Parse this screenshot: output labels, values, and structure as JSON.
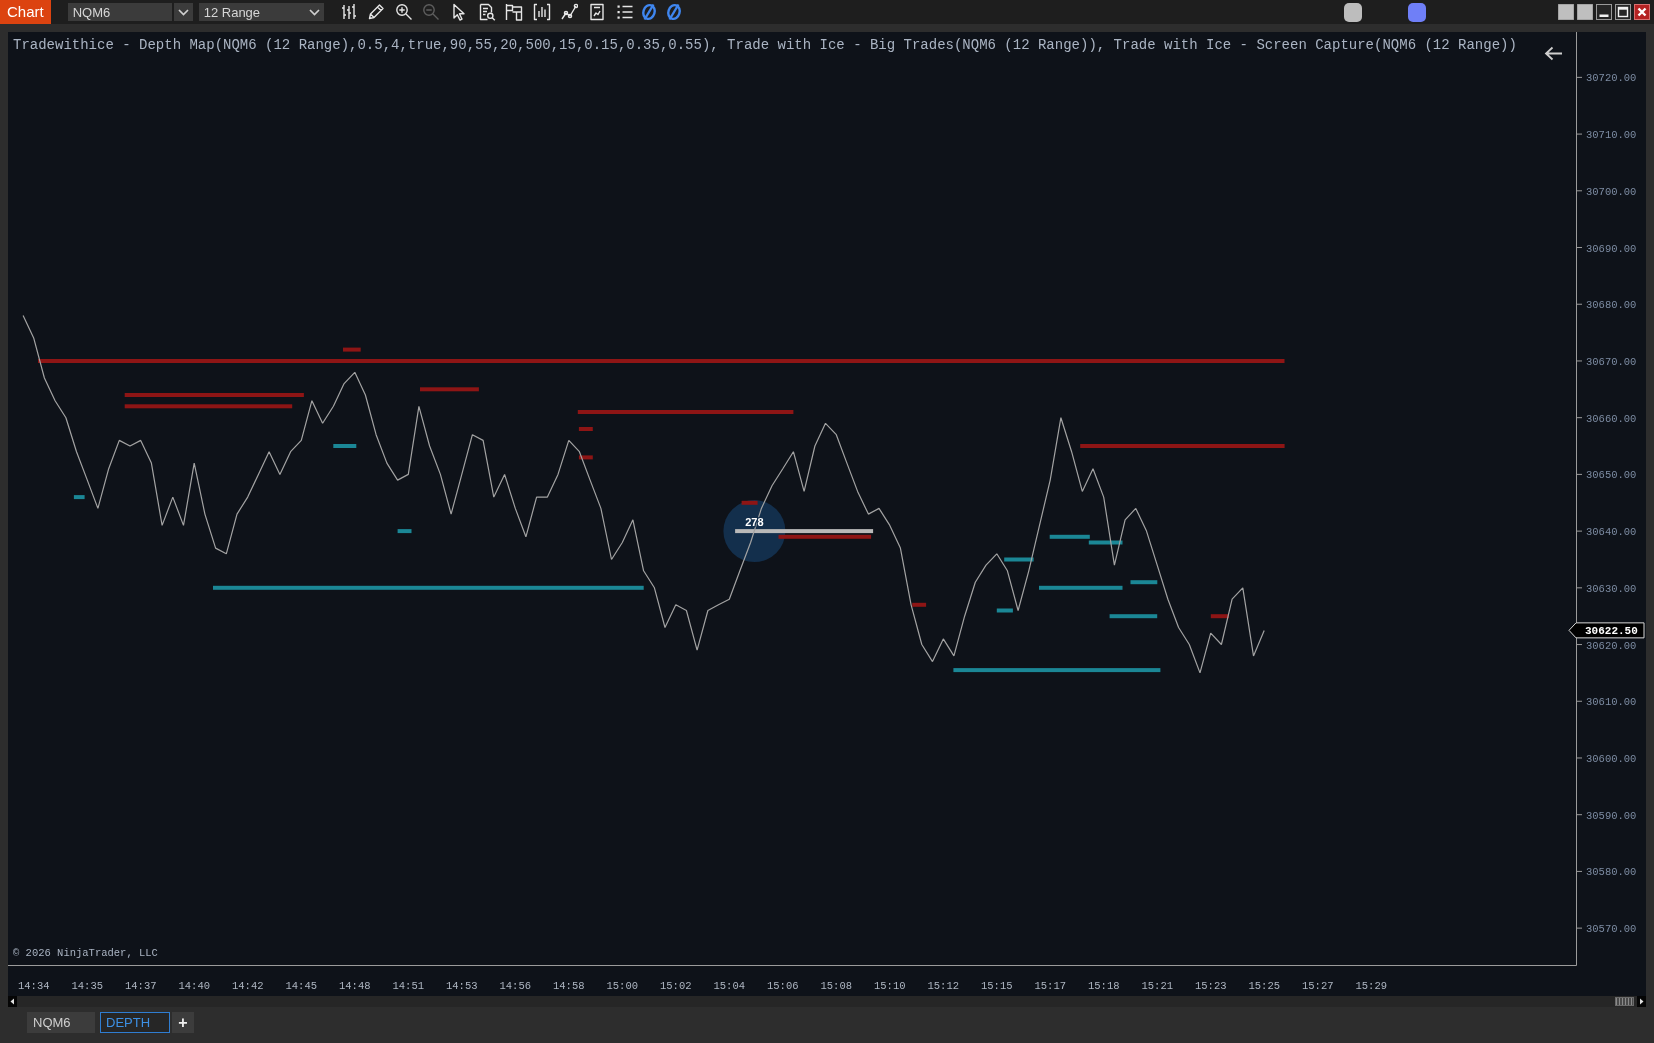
{
  "toolbar": {
    "title": "Chart",
    "instrument": "NQM6",
    "interval": "12 Range",
    "tools": [
      {
        "kind": "bars",
        "disabled": false
      },
      {
        "kind": "pencil",
        "disabled": false
      },
      {
        "kind": "zoom_in",
        "disabled": false
      },
      {
        "kind": "zoom_out",
        "disabled": true
      },
      {
        "kind": "pointer",
        "disabled": false
      },
      {
        "kind": "doc_search",
        "disabled": false
      },
      {
        "kind": "panel",
        "disabled": false
      },
      {
        "kind": "bar_chart",
        "disabled": false
      },
      {
        "kind": "line_chart",
        "disabled": false
      },
      {
        "kind": "doc_chart",
        "disabled": false
      },
      {
        "kind": "list",
        "disabled": false
      },
      {
        "kind": "slashed_circle",
        "disabled": false
      },
      {
        "kind": "slashed_circle",
        "disabled": false
      }
    ],
    "link_buttons": [
      {
        "color": "#bdbdbd"
      },
      {
        "color": "#6f7ff7"
      }
    ]
  },
  "chart": {
    "legend": "Tradewithice - Depth Map(NQM6 (12 Range),0.5,4,true,90,55,20,500,15,0.15,0.35,0.55), Trade with Ice - Big Trades(NQM6 (12 Range)), Trade with Ice - Screen Capture(NQM6 (12 Range))",
    "copyright": "© 2026 NinjaTrader, LLC",
    "last_price": "30622.50",
    "big_trade_label": "278",
    "chart_data": {
      "type": "line",
      "ylim": [
        30563.5,
        30728
      ],
      "categories": [
        null,
        null,
        "14:34",
        null,
        null,
        null,
        null,
        "14:35",
        null,
        null,
        null,
        null,
        "14:37",
        null,
        null,
        null,
        null,
        "14:40",
        null,
        null,
        null,
        null,
        "14:42",
        null,
        null,
        null,
        null,
        "14:45",
        null,
        null,
        null,
        null,
        "14:48",
        null,
        null,
        null,
        null,
        "14:51",
        null,
        null,
        null,
        null,
        "14:53",
        null,
        null,
        null,
        null,
        "14:56",
        null,
        null,
        null,
        null,
        "14:58",
        null,
        null,
        null,
        null,
        "15:00",
        null,
        null,
        null,
        null,
        "15:02",
        null,
        null,
        null,
        null,
        "15:04",
        null,
        null,
        null,
        null,
        "15:06",
        null,
        null,
        null,
        null,
        "15:08",
        null,
        null,
        null,
        null,
        "15:10",
        null,
        null,
        null,
        null,
        "15:12",
        null,
        null,
        null,
        null,
        "15:15",
        null,
        null,
        null,
        null,
        "15:17",
        null,
        null,
        null,
        null,
        "15:18",
        null,
        null,
        null,
        null,
        "15:21",
        null,
        null,
        null,
        null,
        "15:23",
        null,
        null,
        null,
        null,
        "15:25",
        null,
        null,
        null,
        null,
        "15:27",
        null,
        null,
        null,
        null,
        "15:29"
      ],
      "yticks": [
        {
          "value": 30720,
          "label": "30720.00"
        },
        {
          "value": 30710,
          "label": "30710.00"
        },
        {
          "value": 30700,
          "label": "30700.00"
        },
        {
          "value": 30690,
          "label": "30690.00"
        },
        {
          "value": 30680,
          "label": "30680.00"
        },
        {
          "value": 30670,
          "label": "30670.00"
        },
        {
          "value": 30660,
          "label": "30660.00"
        },
        {
          "value": 30650,
          "label": "30650.00"
        },
        {
          "value": 30640,
          "label": "30640.00"
        },
        {
          "value": 30630,
          "label": "30630.00"
        },
        {
          "value": 30620,
          "label": "30620.00"
        },
        {
          "value": 30610,
          "label": "30610.00"
        },
        {
          "value": 30600,
          "label": "30600.00"
        },
        {
          "value": 30590,
          "label": "30590.00"
        },
        {
          "value": 30580,
          "label": "30580.00"
        },
        {
          "value": 30570,
          "label": "30570.00"
        }
      ],
      "series": [
        {
          "color": "#a3a3a3",
          "values": [
            null,
            30678,
            30674,
            30667,
            30663,
            30660,
            30654,
            30649,
            30644,
            30651,
            30656,
            30655,
            30656,
            30652,
            30641,
            30646,
            30641,
            30652,
            30643,
            30637,
            30636,
            30643,
            30646,
            30650,
            30654,
            30650,
            30654,
            30656,
            30663,
            30659,
            30662,
            30666,
            30668,
            30664,
            30657,
            30652,
            30649,
            30650,
            30662,
            30655,
            30650,
            30643,
            30650,
            30657,
            30656,
            30646,
            30650,
            30644,
            30639,
            30646,
            30646,
            30650,
            30656,
            30654,
            30649,
            30644,
            30635,
            30638,
            30642,
            30633,
            30630,
            30623,
            30627,
            30626,
            30619,
            30626,
            30627,
            30628,
            30633,
            30638,
            30644,
            30648,
            30651,
            30654,
            30647,
            30655,
            30659,
            30657,
            30652,
            30647,
            30643,
            30644,
            30641,
            30637,
            30627,
            30620,
            30617,
            30621,
            30618,
            30625,
            30631,
            30634,
            30636,
            30633,
            30626,
            30633,
            30641,
            30649,
            30660,
            30654,
            30647,
            30651,
            30646,
            30634,
            30642,
            30644,
            30640,
            30634,
            30628,
            30623,
            30620,
            30615,
            30622,
            30620,
            30628,
            30630,
            30618,
            30622.5,
            null,
            null,
            null,
            null,
            null,
            null,
            null,
            null,
            null,
            null
          ]
        }
      ]
    }
  },
  "tabs": [
    {
      "label": "NQM6",
      "selected": false
    },
    {
      "label": "DEPTH",
      "selected": true
    }
  ],
  "add_tab": "+"
}
